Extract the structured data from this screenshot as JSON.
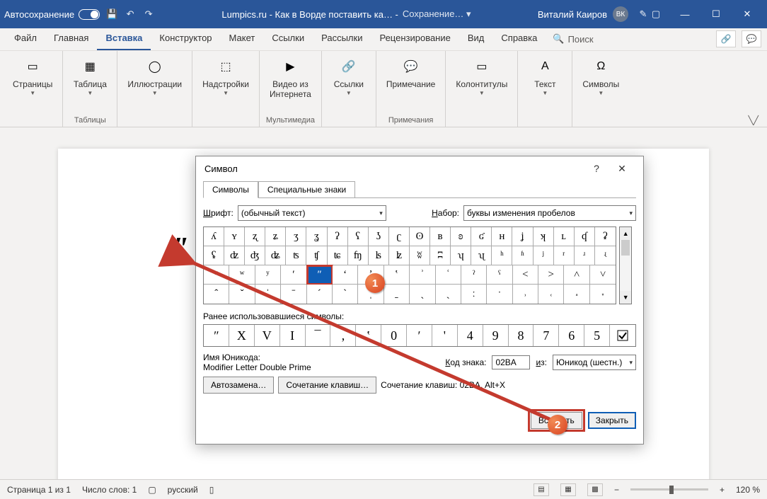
{
  "titlebar": {
    "autosave": "Автосохранение",
    "doc_title": "Lumpics.ru - Как в Ворде поставить ка… -",
    "save_status": "Сохранение… ▾",
    "user_name": "Виталий Каиров",
    "user_initials": "ВК"
  },
  "menu": {
    "items": [
      "Файл",
      "Главная",
      "Вставка",
      "Конструктор",
      "Макет",
      "Ссылки",
      "Рассылки",
      "Рецензирование",
      "Вид",
      "Справка"
    ],
    "active_index": 2,
    "search": "Поиск"
  },
  "ribbon": {
    "groups": [
      {
        "label": "",
        "buttons": [
          {
            "label": "Страницы",
            "caret": true
          }
        ]
      },
      {
        "label": "Таблицы",
        "buttons": [
          {
            "label": "Таблица",
            "caret": true
          }
        ]
      },
      {
        "label": "",
        "buttons": [
          {
            "label": "Иллюстрации",
            "caret": true
          }
        ]
      },
      {
        "label": "",
        "buttons": [
          {
            "label": "Надстройки",
            "caret": true
          }
        ]
      },
      {
        "label": "Мультимедиа",
        "buttons": [
          {
            "label": "Видео из\nИнтернета",
            "caret": false
          }
        ]
      },
      {
        "label": "",
        "buttons": [
          {
            "label": "Ссылки",
            "caret": true
          }
        ]
      },
      {
        "label": "Примечания",
        "buttons": [
          {
            "label": "Примечание",
            "caret": false
          }
        ]
      },
      {
        "label": "",
        "buttons": [
          {
            "label": "Колонтитулы",
            "caret": true
          }
        ]
      },
      {
        "label": "",
        "buttons": [
          {
            "label": "Текст",
            "caret": true
          }
        ]
      },
      {
        "label": "",
        "buttons": [
          {
            "label": "Символы",
            "caret": true
          }
        ]
      }
    ]
  },
  "document": {
    "entered_text": "ʺ"
  },
  "dialog": {
    "title": "Символ",
    "tabs": [
      "Символы",
      "Специальные знаки"
    ],
    "active_tab": 0,
    "font_label": "Шрифт:",
    "font_value": "(обычный текст)",
    "set_label": "Набор:",
    "set_value": "буквы изменения пробелов",
    "grid": [
      [
        "ʎ",
        "ʏ",
        "ʐ",
        "ʑ",
        "ʒ",
        "ʓ",
        "ʔ",
        "ʕ",
        "ʖ",
        "ʗ",
        "ʘ",
        "ʙ",
        "ʚ",
        "ʛ",
        "ʜ",
        "ʝ",
        "ʞ",
        "ʟ",
        "ʠ",
        "ʡ"
      ],
      [
        "ʢ",
        "ʣ",
        "ʤ",
        "ʥ",
        "ʦ",
        "ʧ",
        "ʨ",
        "ʩ",
        "ʪ",
        "ʫ",
        "ʬ",
        "ʭ",
        "ʮ",
        "ʯ",
        "ʰ",
        "ʱ",
        "ʲ",
        "ʳ",
        "ʴ",
        "ʵ"
      ],
      [
        "ʶ",
        "ʷ",
        "ʸ",
        "ʹ",
        "ʺ",
        "ʻ",
        "ʼ",
        "ʽ",
        "ʾ",
        "ʿ",
        "ˀ",
        "ˁ",
        "˂",
        "˃",
        "˄",
        "˅"
      ],
      [
        "ˆ",
        "ˇ",
        "ˈ",
        "ˉ",
        "ˊ",
        "ˋ",
        "ˌ",
        "ˍ",
        "ˎ",
        "ˏ",
        "ː",
        "ˑ",
        "˒",
        "˓",
        "˔",
        "˕"
      ]
    ],
    "selected": {
      "row": 2,
      "col": 4
    },
    "recent_label": "Ранее использовавшиеся символы:",
    "recent": [
      "ʺ",
      "X",
      "V",
      "I",
      "¯",
      "‚",
      "‛",
      "0",
      "ʹ",
      "'",
      "4",
      "9",
      "8",
      "7",
      "6",
      "5",
      "☑"
    ],
    "unicode_name_label": "Имя Юникода:",
    "unicode_name": "Modifier Letter Double Prime",
    "code_label": "Код знака:",
    "code_value": "02BA",
    "from_label": "из:",
    "from_value": "Юникод (шестн.)",
    "autocorrect_btn": "Автозамена…",
    "shortcut_btn": "Сочетание клавиш…",
    "shortcut_label": "Сочетание клавиш: 02BA, Alt+X",
    "insert_btn": "Вставить",
    "close_btn": "Закрыть"
  },
  "statusbar": {
    "page": "Страница 1 из 1",
    "words": "Число слов: 1",
    "lang": "русский",
    "zoom": "120 %"
  },
  "annotations": {
    "n1": "1",
    "n2": "2"
  }
}
